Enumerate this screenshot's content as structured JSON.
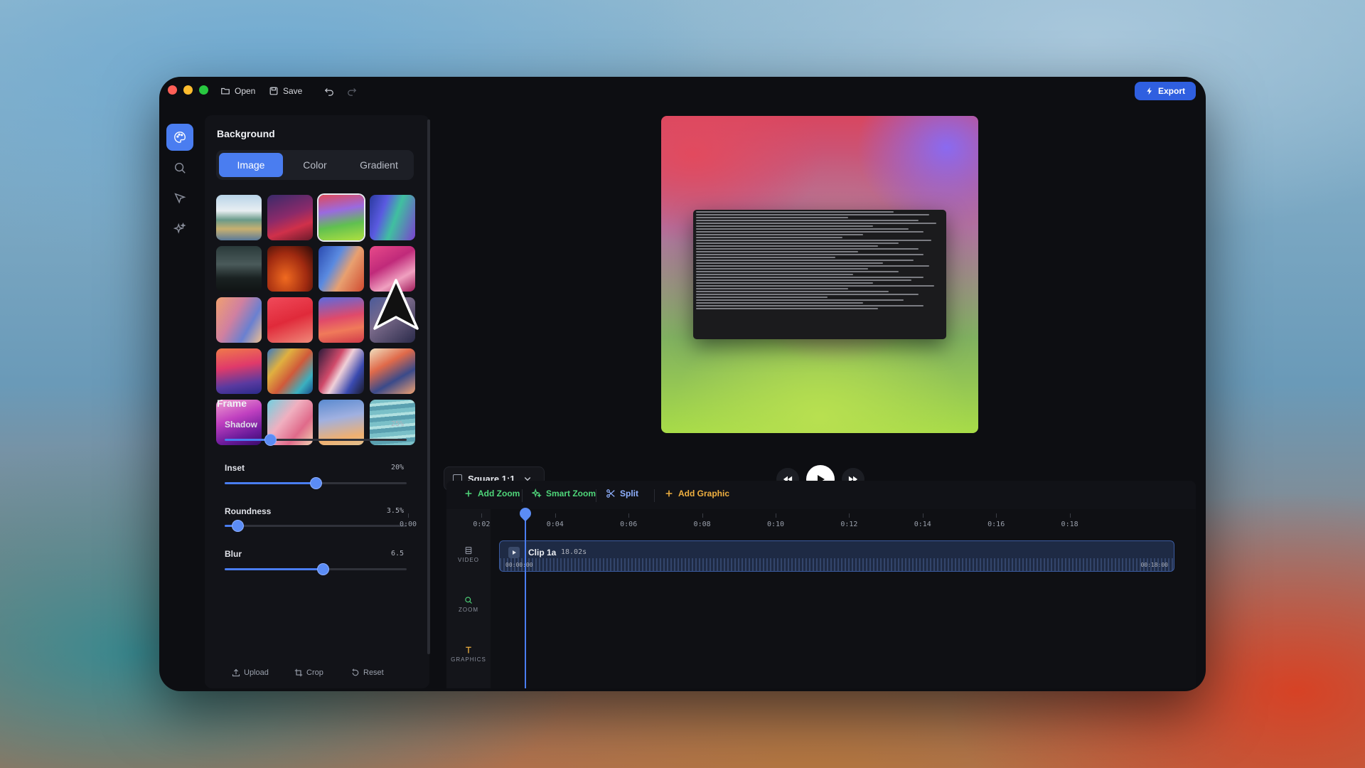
{
  "toolbar": {
    "open_label": "Open",
    "save_label": "Save",
    "export_label": "Export"
  },
  "sidebar_rail": {
    "items": [
      "palette-icon",
      "search-icon",
      "cursor-icon",
      "sparkles-icon"
    ],
    "active": "palette-icon"
  },
  "background": {
    "title": "Background",
    "tabs": [
      "Image",
      "Color",
      "Gradient"
    ],
    "active_tab": "Image",
    "selected_thumbnail": 3
  },
  "frame": {
    "title": "Frame",
    "sliders": [
      {
        "label": "Shadow",
        "value": "25%",
        "level": 0.25
      },
      {
        "label": "Inset",
        "value": "20%",
        "level": 0.5
      },
      {
        "label": "Roundness",
        "value": "3.5%",
        "level": 0.07
      },
      {
        "label": "Blur",
        "value": "6.5",
        "level": 0.54
      }
    ]
  },
  "panel_actions": {
    "upload_label": "Upload",
    "crop_label": "Crop",
    "reset_label": "Reset"
  },
  "aspect": {
    "label": "Square 1:1"
  },
  "timeline": {
    "tools": {
      "add_zoom": "Add Zoom",
      "smart_zoom": "Smart Zoom",
      "split": "Split",
      "add_graphic": "Add Graphic"
    },
    "ticks": [
      "0:00",
      "0:02",
      "0:04",
      "0:06",
      "0:08",
      "0:10",
      "0:12",
      "0:14",
      "0:16",
      "0:18"
    ],
    "tracks": {
      "video": "VIDEO",
      "zoom": "ZOOM",
      "graphics": "GRAPHICS"
    },
    "clip": {
      "name": "Clip 1a",
      "duration": "18.02s",
      "start": "00:00:00",
      "end": "00:18:00"
    }
  },
  "colors": {
    "accent": "#4a7df0",
    "export": "#2f5fe0",
    "window_bg": "#0d0e12"
  }
}
